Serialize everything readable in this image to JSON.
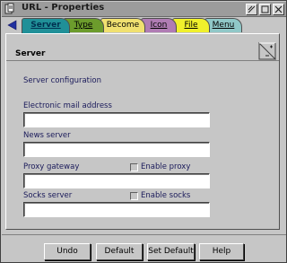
{
  "window": {
    "title": "URL - Properties"
  },
  "tabs": [
    {
      "label": "Server",
      "color": "#209098",
      "active": true
    },
    {
      "label": "Type",
      "color": "#6c9c2c"
    },
    {
      "label": "Become",
      "color": "#f0e070"
    },
    {
      "label": "Icon",
      "color": "#b07cb4"
    },
    {
      "label": "File",
      "color": "#f0f02c"
    },
    {
      "label": "Menu",
      "color": "#90c8c8"
    }
  ],
  "panel": {
    "title": "Server",
    "section_label": "Server configuration",
    "email_label": "Electronic mail address",
    "email_value": "",
    "news_label": "News server",
    "news_value": "",
    "proxy_label": "Proxy gateway",
    "proxy_value": "",
    "enable_proxy_label": "Enable proxy",
    "enable_proxy_checked": false,
    "socks_label": "Socks server",
    "socks_value": "",
    "enable_socks_label": "Enable socks",
    "enable_socks_checked": false
  },
  "buttons": {
    "undo": "Undo",
    "default": "Default",
    "set_default": "Set Default",
    "help": "Help"
  }
}
